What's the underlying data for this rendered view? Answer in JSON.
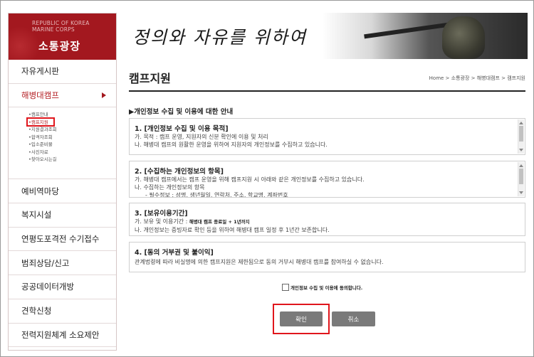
{
  "brand": {
    "eng_line1": "REPUBLIC OF KOREA",
    "eng_line2": "MARINE CORPS",
    "title": "소통광장"
  },
  "sidebar": {
    "items": [
      {
        "label": "자유게시판"
      },
      {
        "label": "해병대캠프"
      },
      {
        "label": "예비역마당"
      },
      {
        "label": "복지시설"
      },
      {
        "label": "연평도포격전 수기접수"
      },
      {
        "label": "범죄상담/신고"
      },
      {
        "label": "공공데이터개방"
      },
      {
        "label": "견학신청"
      },
      {
        "label": "전력지원체계 소요제안"
      }
    ],
    "submenu": [
      "•캠프안내",
      "•캠프지원",
      "•지원결과조회",
      "•합격자조회",
      "•입소준비물",
      "•사진자료",
      "•찾아오시는길"
    ]
  },
  "banner": {
    "slogan": "정의와 자유를 위하여"
  },
  "page": {
    "title": "캠프지원",
    "breadcrumb": "Home > 소통광장 > 해병대캠프 > 캠프지원",
    "notice_heading": "▶개인정보 수집 및 이용에 대한 안내"
  },
  "sections": {
    "s1": {
      "heading": "1. [개인정보 수집 및 이용 목적]",
      "lines": [
        "가. 목적 : 캠프 운영, 지원자의 신분 확인에 이용 및 처리",
        "나. 해병대 캠프의 원활한 운영을 위하여 지원자의 개인정보를 수집하고 있습니다."
      ]
    },
    "s2": {
      "heading": "2. [수집하는 개인정보의 항목]",
      "lines": [
        "가. 해병대 캠프에서는 캠프 운영을 위해 캠프지원 시 아래와 같은 개인정보를 수집하고 있습니다.",
        "나. 수집하는 개인정보의 항목",
        "- 필수정보 : 성명, 생년월일, 연락처, 주소, 학교명, 계좌번호"
      ]
    },
    "s3": {
      "heading": "3. [보유이용기간]",
      "line1_prefix": "가. 보유 및 이용기간 : ",
      "line1_bold": "해병대 캠프 종료일 + 1년까지",
      "line2": "나. 개인정보는 증빙자료 확인 등을 위하여 해병대 캠프 일정 후 1년간 보존합니다."
    },
    "s4": {
      "heading": "4. [동의 거부권 및 불이익]",
      "line": "관계법령에 따라 비실명에 의한 캠프지원은 제한됨으로 동의 거부시 해병대 캠프를 참여하실 수 없습니다."
    }
  },
  "agree": {
    "label": "개인정보 수집 및 이용에 동의합니다."
  },
  "buttons": {
    "confirm": "확인",
    "cancel": "취소"
  },
  "colors": {
    "brand": "#a3181f",
    "highlight": "#e0161c",
    "button": "#7a7a7a"
  }
}
